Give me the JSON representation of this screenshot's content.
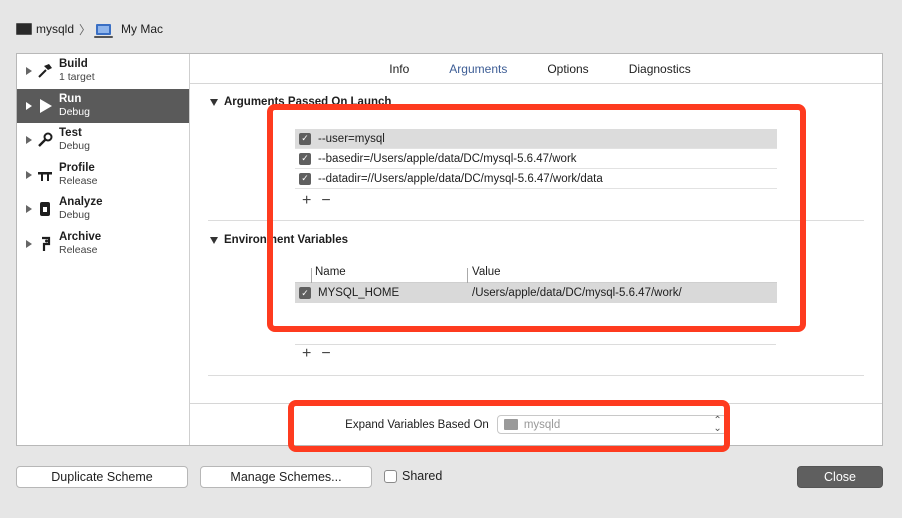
{
  "window": {
    "breadcrumb_scheme": "mysqld",
    "breadcrumb_destination": "My Mac"
  },
  "sidebar": {
    "items": [
      {
        "title": "Build",
        "subtitle": "1 target",
        "icon": "hammer-icon"
      },
      {
        "title": "Run",
        "subtitle": "Debug",
        "icon": "play-icon",
        "selected": true
      },
      {
        "title": "Test",
        "subtitle": "Debug",
        "icon": "wrench-icon"
      },
      {
        "title": "Profile",
        "subtitle": "Release",
        "icon": "caliper-icon"
      },
      {
        "title": "Analyze",
        "subtitle": "Debug",
        "icon": "analyze-icon"
      },
      {
        "title": "Archive",
        "subtitle": "Release",
        "icon": "archive-icon"
      }
    ]
  },
  "tabs": [
    {
      "label": "Info",
      "active": false
    },
    {
      "label": "Arguments",
      "active": true
    },
    {
      "label": "Options",
      "active": false
    },
    {
      "label": "Diagnostics",
      "active": false
    }
  ],
  "arguments": {
    "section_title": "Arguments Passed On Launch",
    "items": [
      {
        "checked": true,
        "value": "--user=mysql"
      },
      {
        "checked": true,
        "value": "--basedir=/Users/apple/data/DC/mysql-5.6.47/work"
      },
      {
        "checked": true,
        "value": "--datadir=//Users/apple/data/DC/mysql-5.6.47/work/data"
      }
    ]
  },
  "environment": {
    "section_title": "Environment Variables",
    "columns": [
      "Name",
      "Value"
    ],
    "rows": [
      {
        "checked": true,
        "name": "MYSQL_HOME",
        "value": "/Users/apple/data/DC/mysql-5.6.47/work/"
      }
    ]
  },
  "controls": {
    "plus": "+",
    "minus": "−"
  },
  "expand": {
    "label": "Expand Variables Based On",
    "selected": "mysqld"
  },
  "footer": {
    "duplicate": "Duplicate Scheme",
    "manage": "Manage Schemes...",
    "shared": "Shared",
    "close": "Close"
  },
  "colors": {
    "annotation": "#fe3b1f",
    "selection": "#5a5a5a",
    "active_tab": "#3d5d95"
  }
}
